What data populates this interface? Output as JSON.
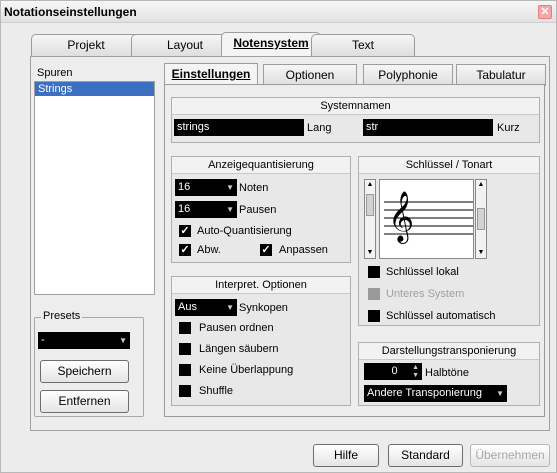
{
  "window": {
    "title": "Notationseinstellungen"
  },
  "top_tabs": [
    {
      "label": "Projekt",
      "active": false
    },
    {
      "label": "Layout",
      "active": false
    },
    {
      "label": "Notensystem",
      "active": true
    },
    {
      "label": "Text",
      "active": false
    }
  ],
  "staves": {
    "header": "Spuren",
    "items": [
      "Strings"
    ]
  },
  "presets": {
    "legend": "Presets",
    "value": "-",
    "save_label": "Speichern",
    "remove_label": "Entfernen"
  },
  "inner_tabs": [
    {
      "label": "Einstellungen",
      "active": true
    },
    {
      "label": "Optionen",
      "active": false
    },
    {
      "label": "Polyphonie",
      "active": false
    },
    {
      "label": "Tabulatur",
      "active": false
    }
  ],
  "staff_names": {
    "title": "Systemnamen",
    "long_value": "strings",
    "long_label": "Lang",
    "short_value": "str",
    "short_label": "Kurz"
  },
  "display_quantize": {
    "title": "Anzeigequantisierung",
    "notes_value": "16",
    "notes_label": "Noten",
    "rests_value": "16",
    "rests_label": "Pausen",
    "auto_quantize_label": "Auto-Quantisierung",
    "auto_quantize_checked": true,
    "dev_label": "Abw.",
    "dev_checked": true,
    "adapt_label": "Anpassen",
    "adapt_checked": true
  },
  "interpret_options": {
    "title": "Interpret. Optionen",
    "syncopation_value": "Aus",
    "syncopation_label": "Synkopen",
    "consolidate_rests_label": "Pausen ordnen",
    "clean_lengths_label": "Längen säubern",
    "no_overlap_label": "Keine Überlappung",
    "shuffle_label": "Shuffle"
  },
  "clef_key": {
    "title": "Schlüssel / Tonart",
    "clef_glyph": "𝄞",
    "local_clef_label": "Schlüssel lokal",
    "lower_staff_label": "Unteres System",
    "auto_clef_label": "Schlüssel automatisch"
  },
  "display_transpose": {
    "title": "Darstellungstransponierung",
    "semitones_value": "0",
    "semitones_label": "Halbtöne",
    "other_transpose_value": "Andere Transponierung"
  },
  "footer": {
    "help_label": "Hilfe",
    "standard_label": "Standard",
    "apply_label": "Übernehmen"
  },
  "colors": {
    "selection": "#3a6fc2",
    "field_bg": "#000000",
    "disabled_text": "#a8a8a8"
  }
}
